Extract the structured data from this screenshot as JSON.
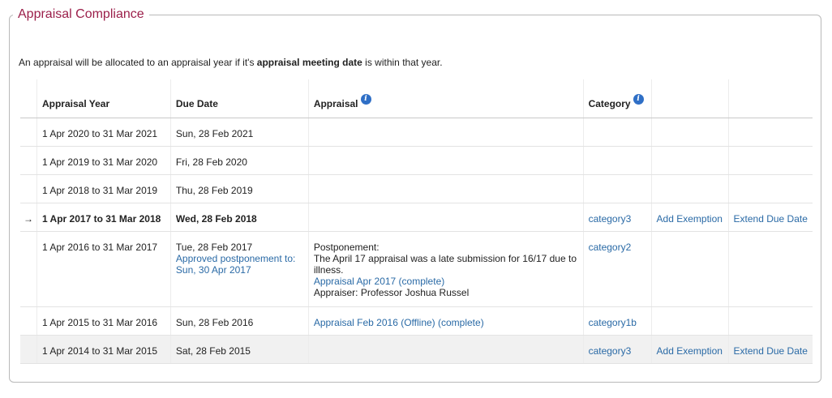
{
  "panel": {
    "title": "Appraisal Compliance",
    "intro_pre": "An appraisal will be allocated to an appraisal year if it's ",
    "intro_bold": "appraisal meeting date",
    "intro_post": " is within that year."
  },
  "table": {
    "headers": {
      "year": "Appraisal Year",
      "due": "Due Date",
      "appraisal": "Appraisal",
      "category": "Category"
    },
    "current_marker": "→",
    "rows": [
      {
        "year": "1 Apr 2020 to 31 Mar 2021",
        "due": "Sun, 28 Feb 2021"
      },
      {
        "year": "1 Apr 2019 to 31 Mar 2020",
        "due": "Fri, 28 Feb 2020"
      },
      {
        "year": "1 Apr 2018 to 31 Mar 2019",
        "due": "Thu, 28 Feb 2019"
      },
      {
        "year": "1 Apr 2017 to 31 Mar 2018",
        "due": "Wed, 28 Feb 2018",
        "category": "category3",
        "action1": "Add Exemption",
        "action2": "Extend Due Date"
      },
      {
        "year": "1 Apr 2016 to 31 Mar 2017",
        "due": "Tue, 28 Feb 2017",
        "due_note": "Approved postponement to: Sun, 30 Apr 2017",
        "postponement_label": "Postponement:",
        "postponement_text": "The April 17 appraisal was a late submission for 16/17 due to illness.",
        "appraisal_link": "Appraisal Apr 2017 (complete)",
        "appraiser": "Appraiser: Professor Joshua Russel",
        "category": "category2"
      },
      {
        "year": "1 Apr 2015 to 31 Mar 2016",
        "due": "Sun, 28 Feb 2016",
        "appraisal_link": "Appraisal Feb 2016 (Offline) (complete)",
        "category": "category1b"
      },
      {
        "year": "1 Apr 2014 to 31 Mar 2015",
        "due": "Sat, 28 Feb 2015",
        "category": "category3",
        "action1": "Add Exemption",
        "action2": "Extend Due Date"
      }
    ]
  },
  "icons": {
    "info": "info-icon"
  },
  "colors": {
    "title": "#9b1f4a",
    "link": "#2a6aa6",
    "info_icon": "#2f6fc6"
  }
}
